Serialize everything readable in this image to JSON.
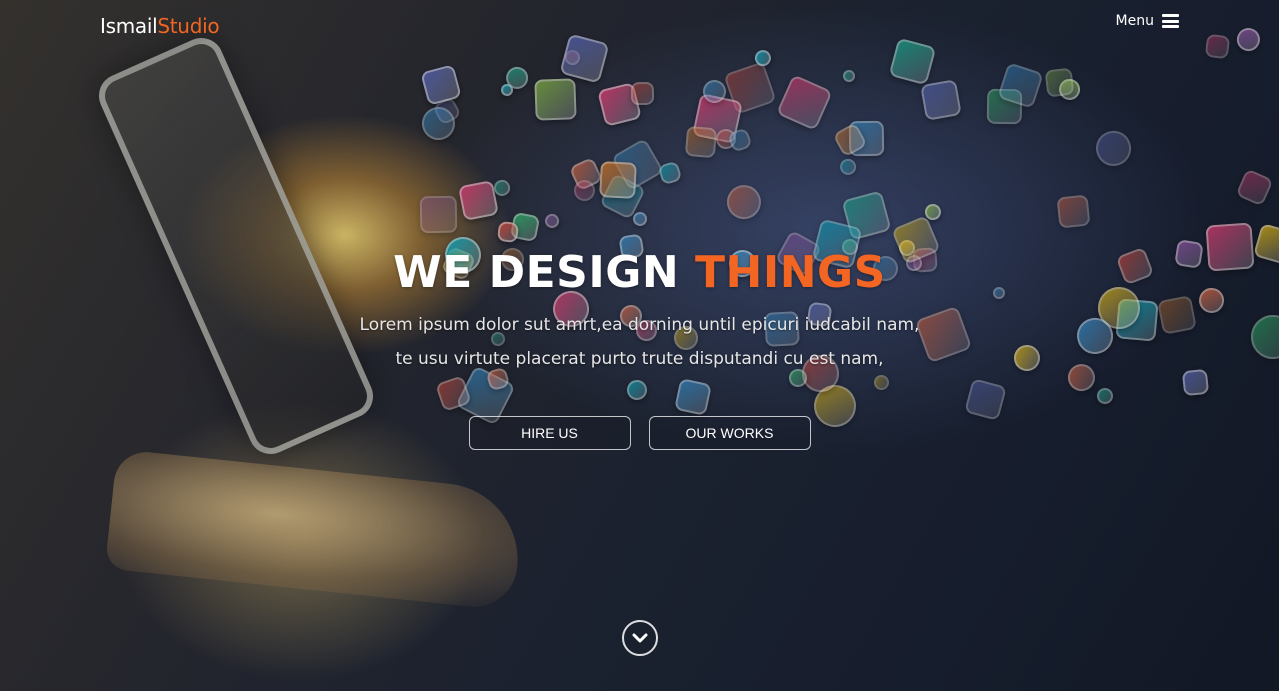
{
  "navbar": {
    "brand_primary": "Ismail",
    "brand_accent": "Studio",
    "menu_label": "Menu",
    "menu_icon": "hamburger-icon"
  },
  "hero": {
    "headline_primary": "WE DESIGN",
    "headline_accent": "THINGS",
    "tagline_line1": "Lorem ipsum dolor sut amrt,ea dorning until epicuri iudcabil nam,",
    "tagline_line2": "te usu virtute placerat purto trute disputandi cu est nam,",
    "buttons": [
      {
        "label": "HIRE US"
      },
      {
        "label": "OUR WORKS"
      }
    ],
    "scroll_icon": "chevron-down-icon"
  },
  "colors": {
    "accent": "#f26522",
    "text": "#ffffff"
  }
}
